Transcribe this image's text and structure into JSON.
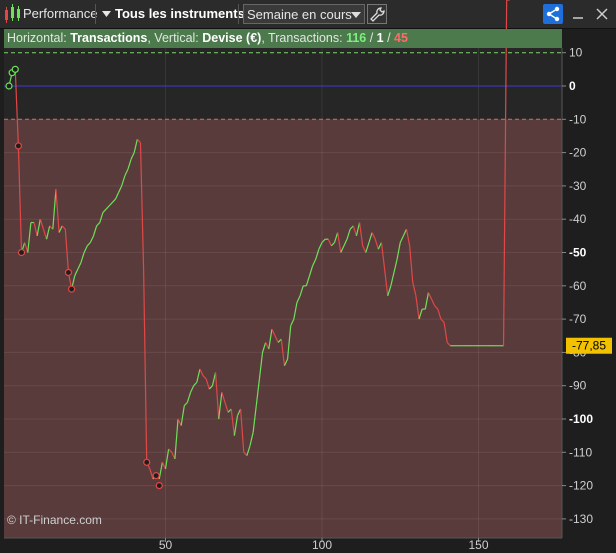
{
  "toolbar": {
    "performance_label": "Performance",
    "instruments_label": "Tous les instruments",
    "period_value": "Semaine en cours"
  },
  "info": {
    "h_prefix": "Horizontal: ",
    "h_value": "Transactions",
    "v_prefix": ", Vertical: ",
    "v_value": "Devise (€)",
    "t_prefix": ", Transactions: ",
    "t_win": "116",
    "slash1": " / ",
    "t_neutral": "1",
    "slash2": " / ",
    "t_loss": "45"
  },
  "watermark": "© IT-Finance.com",
  "colors": {
    "up": "#6ee05a",
    "down": "#e04848",
    "zero_line": "#3a3ad8",
    "win_zone_line": "#7cd66a",
    "loss_zone_line": "#d86a6a",
    "loss_area": "#5a3b3b",
    "neutral_area": "#262626",
    "price_tag": "#f2c200"
  },
  "chart_data": {
    "type": "line",
    "xlabel": "",
    "ylabel": "",
    "xlim": [
      0,
      170
    ],
    "ylim": [
      -130,
      12
    ],
    "x_ticks": [
      50,
      100,
      150
    ],
    "y_ticks": [
      10,
      0,
      -10,
      -20,
      -30,
      -40,
      -50,
      -60,
      -70,
      -80,
      -90,
      -100,
      -110,
      -120,
      -130
    ],
    "bold_y_ticks": [
      0,
      -50,
      -100
    ],
    "reference_lines": [
      10,
      0,
      -10
    ],
    "last_value_label": "-77,85",
    "x": [
      0,
      1,
      2,
      3,
      4,
      5,
      6,
      7,
      8,
      9,
      10,
      11,
      12,
      13,
      14,
      15,
      16,
      17,
      18,
      19,
      20,
      21,
      22,
      23,
      24,
      25,
      26,
      27,
      28,
      29,
      30,
      31,
      32,
      33,
      34,
      35,
      36,
      37,
      38,
      39,
      40,
      41,
      42,
      43,
      44,
      45,
      46,
      47,
      48,
      49,
      50,
      51,
      52,
      53,
      54,
      55,
      56,
      57,
      58,
      59,
      60,
      61,
      62,
      63,
      64,
      65,
      66,
      67,
      68,
      69,
      70,
      71,
      72,
      73,
      74,
      75,
      76,
      77,
      78,
      79,
      80,
      81,
      82,
      83,
      84,
      85,
      86,
      87,
      88,
      89,
      90,
      91,
      92,
      93,
      94,
      95,
      96,
      97,
      98,
      99,
      100,
      101,
      102,
      103,
      104,
      105,
      106,
      107,
      108,
      109,
      110,
      111,
      112,
      113,
      114,
      115,
      116,
      117,
      118,
      119,
      120,
      121,
      122,
      123,
      124,
      125,
      126,
      127,
      128,
      129,
      130,
      131,
      132,
      133,
      134,
      135,
      136,
      137,
      138,
      139,
      140,
      141,
      142,
      143,
      144,
      145,
      146,
      147,
      148,
      149,
      150,
      151,
      152,
      153,
      154,
      155,
      156,
      157,
      158,
      159,
      160,
      161,
      162
    ],
    "y": [
      0,
      4,
      5,
      -18,
      -50,
      -47,
      -50,
      -41,
      -41,
      -45,
      -40,
      -43,
      -46,
      -42,
      -43,
      -31,
      -44,
      -42,
      -43,
      -56,
      -61,
      -57,
      -55,
      -53,
      -50,
      -48,
      -47,
      -45,
      -42,
      -41,
      -38,
      -37,
      -36,
      -35,
      -34,
      -32,
      -30,
      -27,
      -25,
      -22,
      -20,
      -16,
      -17,
      -55,
      -113,
      -115,
      -118,
      -117,
      -118,
      -113,
      -115,
      -109,
      -110,
      -112,
      -100,
      -102,
      -96,
      -95,
      -92,
      -90,
      -89,
      -85,
      -87,
      -88,
      -91,
      -90,
      -86,
      -100,
      -92,
      -95,
      -98,
      -97,
      -105,
      -99,
      -97,
      -110,
      -111,
      -108,
      -104,
      -96,
      -88,
      -80,
      -77,
      -79,
      -73,
      -75,
      -77,
      -76,
      -84,
      -82,
      -72,
      -70,
      -65,
      -63,
      -60,
      -60,
      -57,
      -54,
      -52,
      -49,
      -47,
      -46,
      -46,
      -48,
      -47,
      -44,
      -50,
      -48,
      -46,
      -43,
      -42,
      -45,
      -41,
      -48,
      -50,
      -47,
      -44,
      -46,
      -49,
      -47,
      -55,
      -63,
      -60,
      -56,
      -52,
      -47,
      -45,
      -43,
      -48,
      -59,
      -63,
      -70,
      -67,
      -67,
      -62,
      -64,
      -66,
      -67,
      -70,
      -71,
      -77,
      -78,
      -78,
      -78,
      -78,
      -78,
      -78,
      -78,
      -78,
      -78,
      -78,
      -78,
      -78,
      -78,
      -78,
      -78,
      -78,
      -78,
      -78
    ],
    "markers": [
      {
        "x": 0,
        "y": 0,
        "kind": "win"
      },
      {
        "x": 1,
        "y": 4,
        "kind": "win"
      },
      {
        "x": 2,
        "y": 5,
        "kind": "win"
      },
      {
        "x": 3,
        "y": -18,
        "kind": "loss"
      },
      {
        "x": 4,
        "y": -50,
        "kind": "loss"
      },
      {
        "x": 19,
        "y": -56,
        "kind": "loss"
      },
      {
        "x": 20,
        "y": -61,
        "kind": "loss"
      },
      {
        "x": 44,
        "y": -113,
        "kind": "loss"
      },
      {
        "x": 47,
        "y": -117,
        "kind": "loss"
      },
      {
        "x": 48,
        "y": -120,
        "kind": "loss"
      }
    ]
  }
}
